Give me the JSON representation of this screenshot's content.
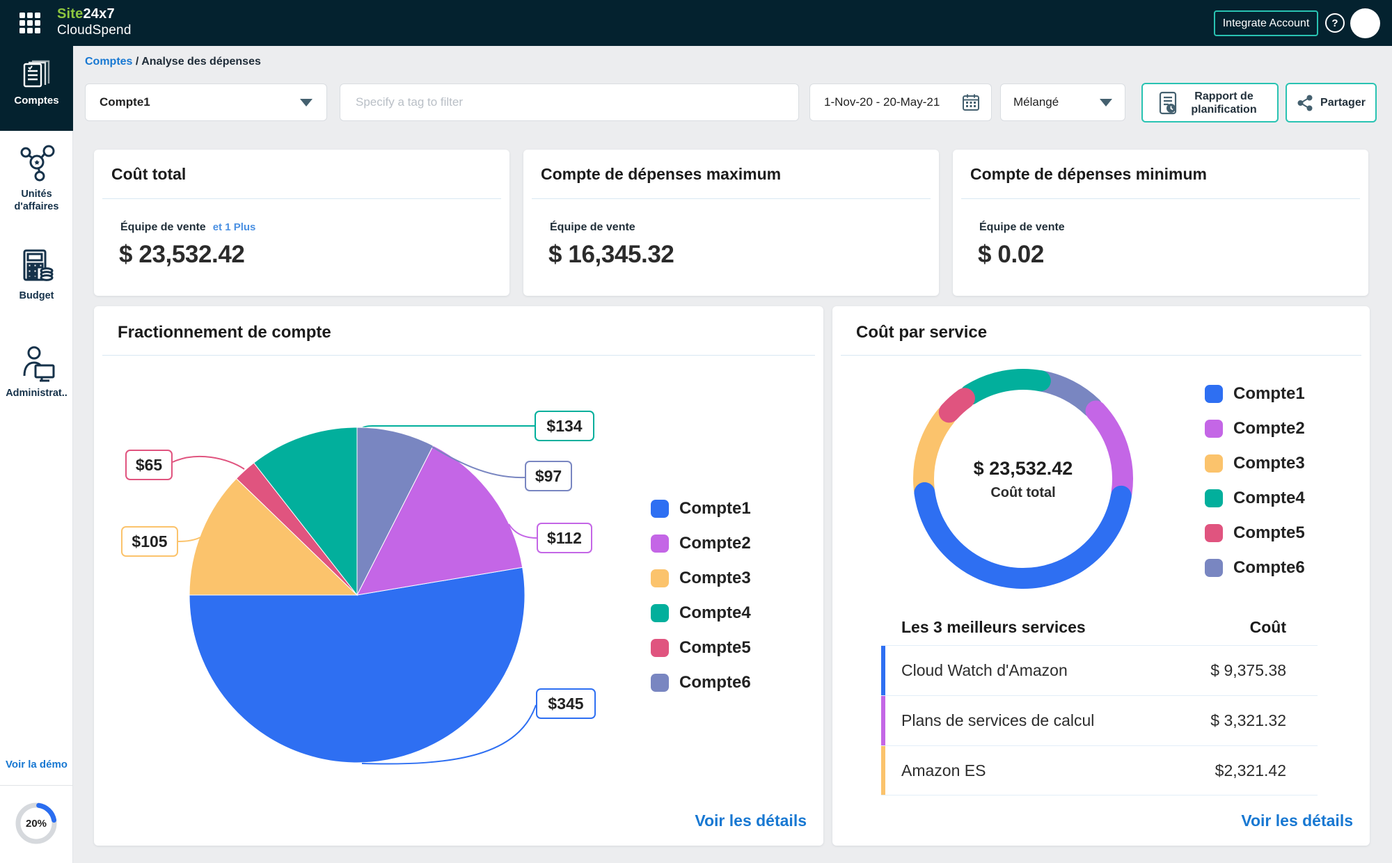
{
  "header": {
    "brand_green": "Site",
    "brand_suffix": "24x7",
    "brand_product": "CloudSpend",
    "integrate_button": "Integrate Account",
    "help_glyph": "?"
  },
  "sidebar": {
    "items": [
      {
        "label": "Comptes",
        "active": true
      },
      {
        "label": "Unités d'affaires",
        "active": false
      },
      {
        "label": "Budget",
        "active": false
      },
      {
        "label": "Administrat..",
        "active": false
      }
    ],
    "demo_link": "Voir la démo",
    "setup_progress": "20%",
    "setup_progress_percent": 20
  },
  "breadcrumb": {
    "parent": "Comptes",
    "separator": "/",
    "current": "Analyse des dépenses"
  },
  "filters": {
    "account_selected": "Compte1",
    "tag_placeholder": "Specify a tag to filter",
    "date_range": "1-Nov-20 - 20-May-21",
    "view_selected": "Mélangé",
    "report_button": "Rapport de planification",
    "share_button": "Partager"
  },
  "stats": [
    {
      "title": "Coût total",
      "label": "Équipe de vente",
      "label_extra": "et 1 Plus",
      "value": "$ 23,532.42"
    },
    {
      "title": "Compte de dépenses maximum",
      "label": "Équipe de vente",
      "label_extra": "",
      "value": "$ 16,345.32"
    },
    {
      "title": "Compte de dépenses minimum",
      "label": "Équipe de vente",
      "label_extra": "",
      "value": "$ 0.02"
    }
  ],
  "colors": {
    "header_bg": "#04222f",
    "accent_teal": "#29c3b2",
    "link_blue": "#1878d2",
    "logo_green": "#8dc63f",
    "progress_blue": "#2a6df0"
  },
  "chart_data": [
    {
      "type": "pie",
      "title": "Fractionnement de compte",
      "legend": [
        "Compte1",
        "Compte2",
        "Compte3",
        "Compte4",
        "Compte5",
        "Compte6"
      ],
      "palette": [
        "#2E6FF2",
        "#C466E6",
        "#FBC36C",
        "#02AF9C",
        "#E0547F",
        "#7986C1"
      ],
      "slices": [
        {
          "name": "Compte1",
          "label": "$345",
          "value": 345,
          "display_start": 80.5,
          "display_end": 270
        },
        {
          "name": "Compte2",
          "label": "$112",
          "value": 112,
          "display_start": 27,
          "display_end": 80.5
        },
        {
          "name": "Compte3",
          "label": "$105",
          "value": 105,
          "display_start": 270,
          "display_end": 314
        },
        {
          "name": "Compte4",
          "label": "$134",
          "value": 134,
          "display_start": 322,
          "display_end": 360
        },
        {
          "name": "Compte5",
          "label": "$65",
          "value": 65,
          "display_start": 314,
          "display_end": 322
        },
        {
          "name": "Compte6",
          "label": "$97",
          "value": 97,
          "display_start": 0,
          "display_end": 27
        }
      ],
      "legend_position": "right",
      "details_link": "Voir les détails"
    },
    {
      "type": "donut",
      "title": "Coût par service",
      "center_value": "$ 23,532.42",
      "center_label": "Coût total",
      "legend": [
        "Compte1",
        "Compte2",
        "Compte3",
        "Compte4",
        "Compte5",
        "Compte6"
      ],
      "palette": [
        "#2E6FF2",
        "#C466E6",
        "#FBC36C",
        "#02AF9C",
        "#E0547F",
        "#7986C1"
      ],
      "segments": [
        {
          "name": "Compte1",
          "display_start": 100,
          "display_end": 262
        },
        {
          "name": "Compte2",
          "display_start": 47,
          "display_end": 98
        },
        {
          "name": "Compte3",
          "display_start": 264,
          "display_end": 309
        },
        {
          "name": "Compte4",
          "display_start": 328,
          "display_end": 370
        },
        {
          "name": "Compte5",
          "display_start": 312,
          "display_end": 324
        },
        {
          "name": "Compte6",
          "display_start": 10,
          "display_end": 44
        }
      ],
      "top_services": {
        "header": [
          "Les 3 meilleurs services",
          "Coût"
        ],
        "rows": [
          {
            "service": "Cloud Watch d'Amazon",
            "cost": "$ 9,375.38",
            "color": "#2E6FF2"
          },
          {
            "service": "Plans de services de calcul",
            "cost": "$ 3,321.32",
            "color": "#C466E6"
          },
          {
            "service": "Amazon ES",
            "cost": "$2,321.42",
            "color": "#FBC36C"
          }
        ]
      },
      "details_link": "Voir les détails"
    }
  ]
}
